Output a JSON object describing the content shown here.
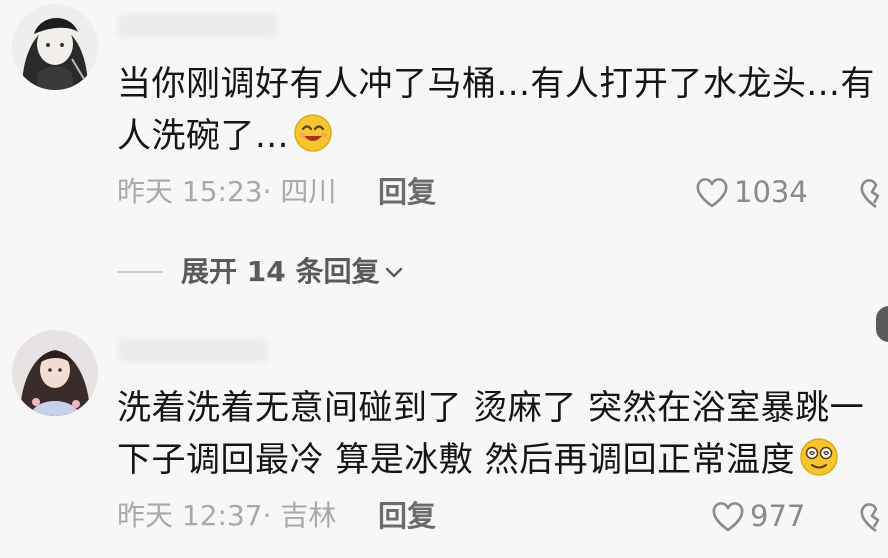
{
  "comments": [
    {
      "avatar_icon": "anime-girl-avatar-icon",
      "text": "当你刚调好有人冲了马桶...有人打开了水龙头...有人洗碗了...",
      "emoji": "smiling-face-icon",
      "time": "昨天 15:23",
      "location": "· 四川",
      "reply_label": "回复",
      "likes": "1034"
    },
    {
      "avatar_icon": "girl-photo-avatar-icon",
      "text": "洗着洗着无意间碰到了 烫麻了 突然在浴室暴跳一下子调回最冷 算是冰敷 然后再调回正常温度",
      "emoji": "dizzy-face-icon",
      "time": "昨天 12:37",
      "location": "· 吉林",
      "reply_label": "回复",
      "likes": "977"
    }
  ],
  "expand_replies": {
    "label": "展开 14 条回复",
    "icon": "chevron-down-icon"
  },
  "colors": {
    "background": "#f7f7f7",
    "text": "#151515",
    "meta": "#a9a9a9",
    "reply": "#6b6b6b",
    "emoji": "#f5c62d"
  }
}
